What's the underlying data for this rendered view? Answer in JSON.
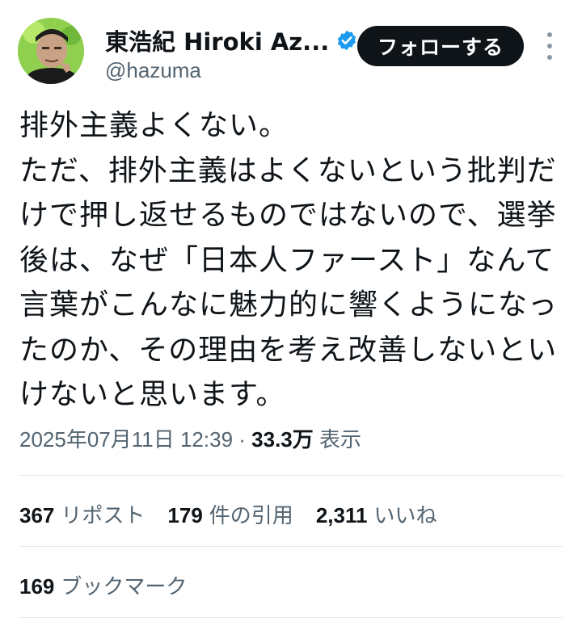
{
  "author": {
    "display_name": "東浩紀 Hiroki Az...",
    "handle": "@hazuma",
    "verified": true,
    "avatar_icon": "user-avatar-photo",
    "follow_label": "フォローする",
    "more_icon": "more-vertical-icon"
  },
  "tweet": {
    "lines": [
      "排外主義よくない。",
      "ただ、排外主義はよくないという批判だ",
      "けで押し返せるものではないので、選挙",
      "後は、なぜ「日本人ファースト」なんて",
      "言葉がこんなに魅力的に響くようになっ",
      "たのか、その理由を考え改善しないとい",
      "けないと思います。"
    ]
  },
  "meta": {
    "timestamp": "2025年07月11日 12:39",
    "separator": " · ",
    "views_count": "33.3万",
    "views_label": "表示"
  },
  "stats": {
    "reposts": {
      "count": "367",
      "label": "リポスト"
    },
    "quotes": {
      "count": "179",
      "label": "件の引用"
    },
    "likes": {
      "count": "2,311",
      "label": "いいね"
    },
    "bookmarks": {
      "count": "169",
      "label": "ブックマーク"
    }
  },
  "colors": {
    "text": "#0f1419",
    "secondary": "#536471",
    "verified_blue": "#1d9bf0",
    "divider": "#e3e7ea",
    "avatar_bg": "#8fd14f"
  }
}
